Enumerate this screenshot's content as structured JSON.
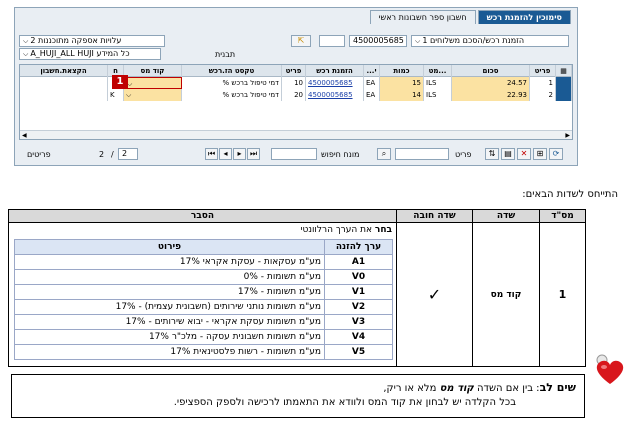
{
  "sap": {
    "tabs": [
      "סימוכין להזמנת רכש",
      "חשבון ספר חשבונות ראשי"
    ],
    "po_scope_selected": "1 הזמנת רכש/הסכם משלוחים",
    "po_number": "4500005685",
    "delivery_note_selected": "2 עלויות אספקה מתוכננות",
    "template_label": "תבנית",
    "template_value": "A_HUJI_ALL HUJI כל המידע",
    "columns": [
      "פריט",
      "סכום",
      "מט...",
      "כמות",
      "...י",
      "הזמנת רכש",
      "פריט",
      "טקסט הז.רכש",
      "קוד מס",
      "ח",
      "הקצאת.חשבון"
    ],
    "rows": [
      {
        "item": "1",
        "amount": "24.57",
        "currency": "ILS",
        "qty": "15",
        "unit": "EA",
        "po": "4500005685",
        "po_item": "10",
        "text": "% דמי טיפול ברכש",
        "tax": "",
        "h": ""
      },
      {
        "item": "2",
        "amount": "22.93",
        "currency": "ILS",
        "qty": "14",
        "unit": "EA",
        "po": "4500005685",
        "po_item": "20",
        "text": "% דמי טיפול ברכש",
        "tax": "",
        "h": "K"
      }
    ],
    "callout_number": "1",
    "item_label": "פריט",
    "search_label": "מונח חיפוש",
    "items_label": "פריטים",
    "page_current": "2",
    "page_sep": "/",
    "page_total": "2"
  },
  "intro": "התייחס לשדות הבאים:",
  "table": {
    "headers": [
      "מס\"ד",
      "שדה",
      "שדה חובה",
      "הסבר"
    ],
    "row_num": "1",
    "field": "קוד מס",
    "required_mark": "✓",
    "explain_bold": "בחר",
    "explain_rest": " את הערך הרלוונטי",
    "inner_headers": [
      "ערך להזנה",
      "פירוט"
    ],
    "codes": [
      {
        "code": "A1",
        "desc": "מע\"מ עסקאות - עסקת אקראי 17%"
      },
      {
        "code": "V0",
        "desc": "מע\"מ תשומות - 0%"
      },
      {
        "code": "V1",
        "desc": "מע\"מ תשומות - 17%"
      },
      {
        "code": "V2",
        "desc": "מע\"מ תשומות נותני שירותים (חשבונית עצמית) - 17%"
      },
      {
        "code": "V3",
        "desc": "מע\"מ תשומות עסקת אקראי - יבוא שירותים - 17%"
      },
      {
        "code": "V4",
        "desc": "מע\"מ תשומות חשבונית עסקה - מלכ\"ר 17%"
      },
      {
        "code": "V5",
        "desc": "מע\"מ תשומות - רשות פלסטינאית 17%"
      }
    ]
  },
  "note": {
    "title": "שים לב",
    "line1_a": ": בין אם השדה ",
    "line1_b": "קוד מס",
    "line1_c": " מלא או ריק,",
    "line2": "בכל הקלדה יש לבחון את קוד המס ולוודא את התאמתו לרכישה ולספק הספציפי."
  },
  "colors": {
    "sap_blue": "#1a5a94",
    "highlight_yellow": "#fbe2a2",
    "callout_red": "#c00000"
  }
}
